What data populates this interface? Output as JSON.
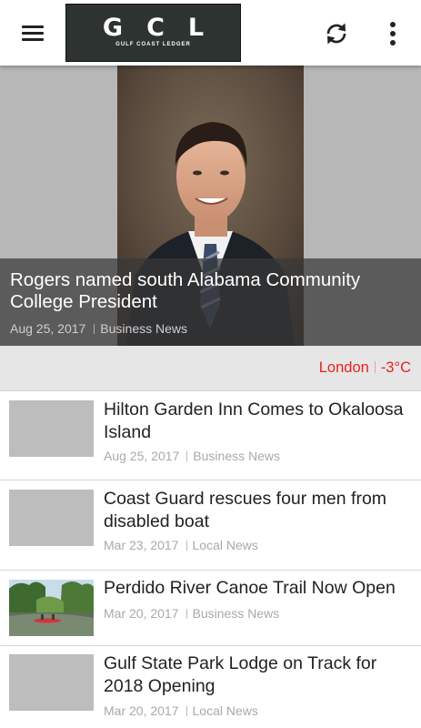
{
  "header": {
    "menu_icon": "hamburger-menu-icon",
    "logo_letters": "GCL",
    "logo_subtitle": "GULF COAST LEDGER",
    "refresh_icon": "refresh-icon",
    "more_icon": "more-vert-icon"
  },
  "hero": {
    "title": "Rogers named south Alabama Community College President",
    "date": "Aug 25, 2017",
    "category": "Business News"
  },
  "weather": {
    "city": "London",
    "temperature": "-3°C",
    "color": "#e8221e"
  },
  "news": [
    {
      "title": "Hilton Garden Inn Comes to Okaloosa Island",
      "date": "Aug 25, 2017",
      "category": "Business News"
    },
    {
      "title": "Coast Guard rescues four men from disabled boat",
      "date": "Mar 23, 2017",
      "category": "Local News"
    },
    {
      "title": "Perdido River Canoe Trail Now Open",
      "date": "Mar 20, 2017",
      "category": "Business News"
    },
    {
      "title": "Gulf State Park Lodge on Track for 2018 Opening",
      "date": "Mar 20, 2017",
      "category": "Local News"
    }
  ]
}
